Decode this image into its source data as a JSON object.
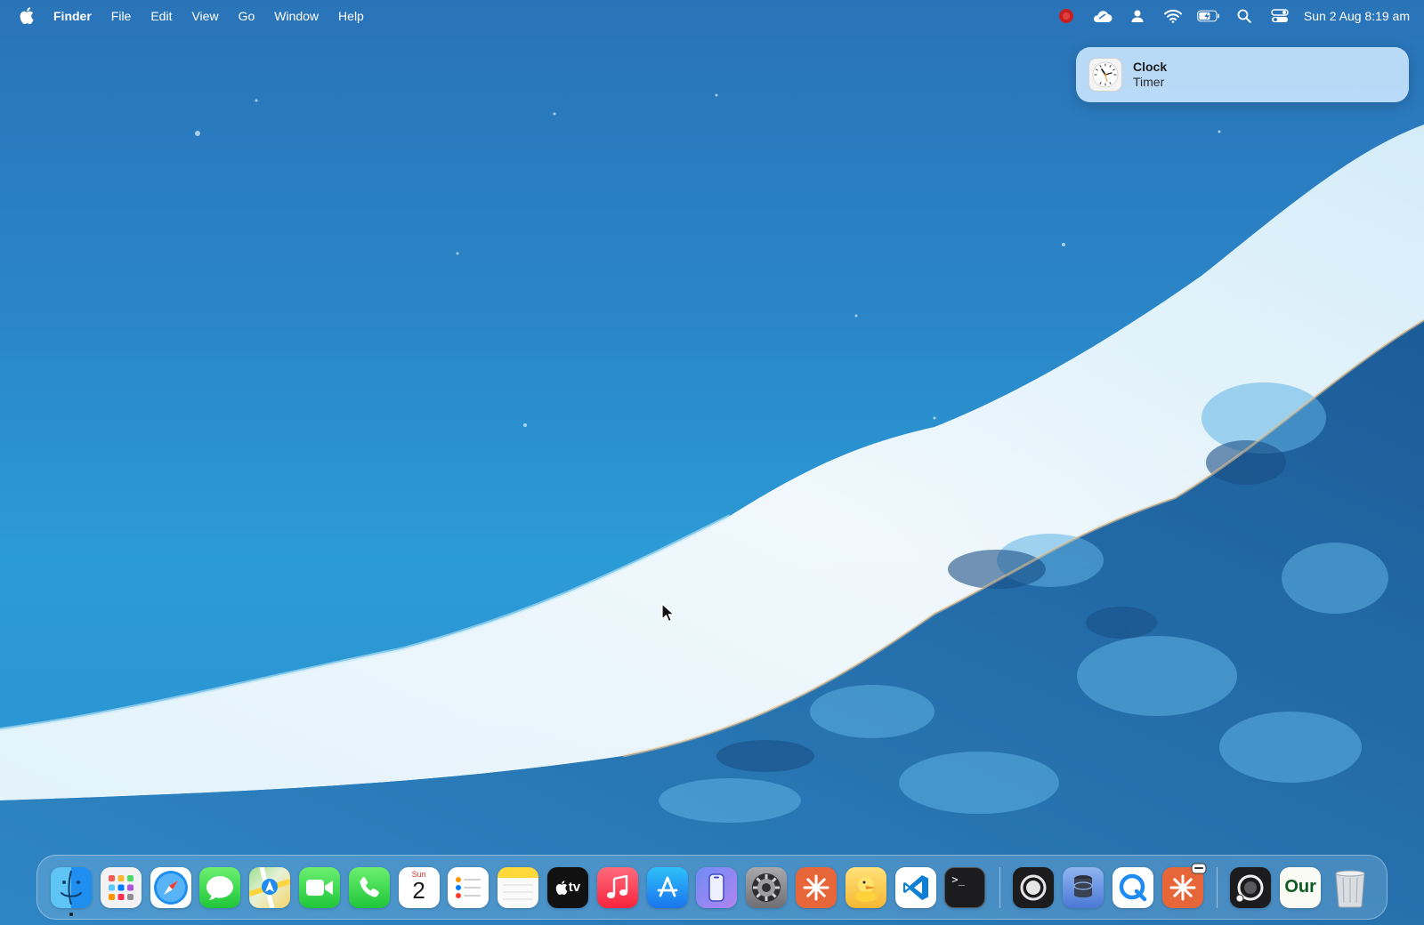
{
  "menubar": {
    "app_name": "Finder",
    "menus": [
      "File",
      "Edit",
      "View",
      "Go",
      "Window",
      "Help"
    ],
    "status_icons": [
      "screen-record-icon",
      "cloud-icon",
      "user-icon",
      "wifi-icon",
      "battery-icon",
      "search-icon",
      "control-center-icon"
    ],
    "datetime": "Sun 2 Aug  8:19 am"
  },
  "notification": {
    "app_icon": "clock-icon",
    "title": "Clock",
    "subtitle": "Timer"
  },
  "dock": {
    "apps": [
      {
        "name": "finder",
        "icon": "finder-icon",
        "running": true
      },
      {
        "name": "launchpad",
        "icon": "launchpad-icon"
      },
      {
        "name": "safari",
        "icon": "safari-icon"
      },
      {
        "name": "messages",
        "icon": "messages-icon"
      },
      {
        "name": "maps",
        "icon": "maps-icon"
      },
      {
        "name": "facetime",
        "icon": "facetime-icon"
      },
      {
        "name": "phone",
        "icon": "phone-icon"
      },
      {
        "name": "calendar",
        "icon": "calendar-icon",
        "day": "Sun",
        "date": "2"
      },
      {
        "name": "reminders",
        "icon": "reminders-icon"
      },
      {
        "name": "notes",
        "icon": "notes-icon"
      },
      {
        "name": "apple-tv",
        "icon": "apple-tv-icon",
        "label": "tv"
      },
      {
        "name": "music",
        "icon": "music-icon"
      },
      {
        "name": "app-store",
        "icon": "app-store-icon"
      },
      {
        "name": "iphone-mirroring",
        "icon": "iphone-mirroring-icon"
      },
      {
        "name": "system-settings",
        "icon": "gear-icon"
      },
      {
        "name": "claude",
        "icon": "claude-icon"
      },
      {
        "name": "cyberduck",
        "icon": "duck-icon"
      },
      {
        "name": "vscode",
        "icon": "vscode-icon"
      },
      {
        "name": "terminal",
        "icon": "terminal-icon",
        "label": ">_"
      },
      {
        "name": "screen-recorder",
        "icon": "record-circle-icon"
      },
      {
        "name": "db-tool",
        "icon": "database-icon"
      },
      {
        "name": "qt-app",
        "icon": "q-icon"
      },
      {
        "name": "claude-2",
        "icon": "claude-badge-icon"
      },
      {
        "name": "screenshot-tool",
        "icon": "capture-icon"
      },
      {
        "name": "our-app",
        "icon": "our-icon",
        "label": "Our"
      },
      {
        "name": "trash",
        "icon": "trash-icon"
      }
    ]
  },
  "colors": {
    "menubar_text": "#ffffff",
    "notification_bg": "#c4e2fc",
    "dock_bg": "#96c8eb"
  }
}
